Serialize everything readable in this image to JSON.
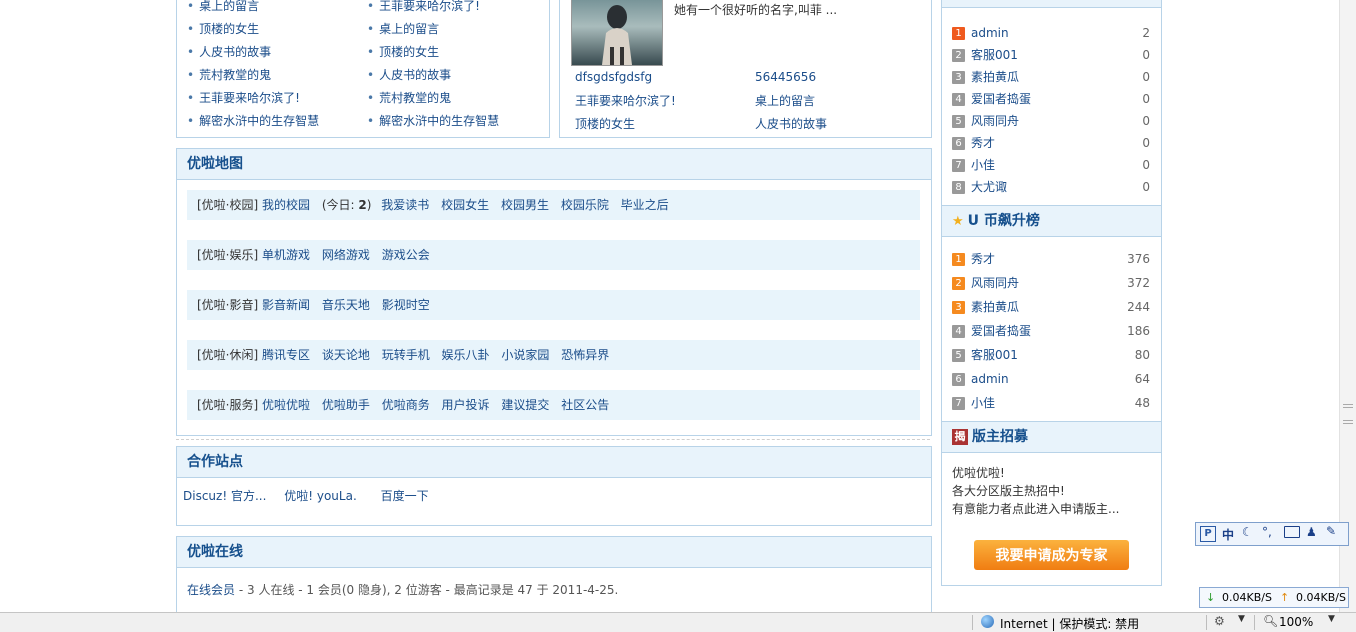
{
  "posts_left": [
    "桌上的留言",
    "顶楼的女生",
    "人皮书的故事",
    "荒村教堂的鬼",
    "王菲要来哈尔滨了!",
    "解密水浒中的生存智慧"
  ],
  "posts_right": [
    "王菲要来哈尔滨了!",
    "桌上的留言",
    "顶楼的女生",
    "人皮书的故事",
    "荒村教堂的鬼",
    "解密水浒中的生存智慧"
  ],
  "profile": {
    "desc": "她有一个很好听的名字,叫菲 ...",
    "name": "dfsgdsfgdsfg",
    "id": "56445656",
    "links": [
      "王菲要来哈尔滨了!",
      "桌上的留言",
      "顶楼的女生",
      "人皮书的故事"
    ]
  },
  "map": {
    "title": "优啦地图",
    "rows": [
      {
        "cat": "[优啦·校园]",
        "links": [
          "我的校园",
          "我爱读书",
          "校园女生",
          "校园男生",
          "校园乐院",
          "毕业之后"
        ],
        "today_prefix": "(今日: ",
        "today_count": "2",
        "today_suffix": ")"
      },
      {
        "cat": "[优啦·娱乐]",
        "links": [
          "单机游戏",
          "网络游戏",
          "游戏公会"
        ]
      },
      {
        "cat": "[优啦·影音]",
        "links": [
          "影音新闻",
          "音乐天地",
          "影视时空"
        ]
      },
      {
        "cat": "[优啦·休闲]",
        "links": [
          "腾讯专区",
          "谈天论地",
          "玩转手机",
          "娱乐八卦",
          "小说家园",
          "恐怖异界"
        ]
      },
      {
        "cat": "[优啦·服务]",
        "links": [
          "优啦优啦",
          "优啦助手",
          "优啦商务",
          "用户投诉",
          "建议提交",
          "社区公告"
        ]
      }
    ]
  },
  "partners": {
    "title": "合作站点",
    "links": [
      "Discuz! 官方...",
      "优啦! youLa.",
      "百度一下"
    ]
  },
  "online": {
    "title": "优啦在线",
    "members_label": "在线会员",
    "summary": "- 3 人在线 - 1 会员(0 隐身), 2 位游客 - 最高记录是 47 于 2011-4-25."
  },
  "rank1": {
    "items": [
      {
        "n": "1",
        "name": "admin",
        "v": "2"
      },
      {
        "n": "2",
        "name": "客服001",
        "v": "0"
      },
      {
        "n": "3",
        "name": "素拍黄瓜",
        "v": "0"
      },
      {
        "n": "4",
        "name": "爱国者捣蛋",
        "v": "0"
      },
      {
        "n": "5",
        "name": "风雨同舟",
        "v": "0"
      },
      {
        "n": "6",
        "name": "秀才",
        "v": "0"
      },
      {
        "n": "7",
        "name": "小佳",
        "v": "0"
      },
      {
        "n": "8",
        "name": "大尤诹",
        "v": "0"
      }
    ]
  },
  "rank2": {
    "title": "U 币飙升榜",
    "items": [
      {
        "n": "1",
        "name": "秀才",
        "v": "376"
      },
      {
        "n": "2",
        "name": "风雨同舟",
        "v": "372"
      },
      {
        "n": "3",
        "name": "素拍黄瓜",
        "v": "244"
      },
      {
        "n": "4",
        "name": "爱国者捣蛋",
        "v": "186"
      },
      {
        "n": "5",
        "name": "客服001",
        "v": "80"
      },
      {
        "n": "6",
        "name": "admin",
        "v": "64"
      },
      {
        "n": "7",
        "name": "小佳",
        "v": "48"
      }
    ]
  },
  "recruit": {
    "title": "版主招募",
    "badge": "揭",
    "lines": [
      "优啦优啦!",
      "各大分区版主热招中!",
      "有意能力者点此进入申请版主..."
    ],
    "button": "我要申请成为专家"
  },
  "ime": {
    "label": "中"
  },
  "netspeed": {
    "down": "0.04KB/S",
    "up": "0.04KB/S"
  },
  "status": {
    "zone": "Internet | 保护模式: 禁用",
    "zoom": "100%"
  },
  "colors": {
    "accent": "#16508d",
    "border": "#b8d3e8",
    "header_bg": "#e8f3fb",
    "rank_top": "#f58a1f"
  }
}
